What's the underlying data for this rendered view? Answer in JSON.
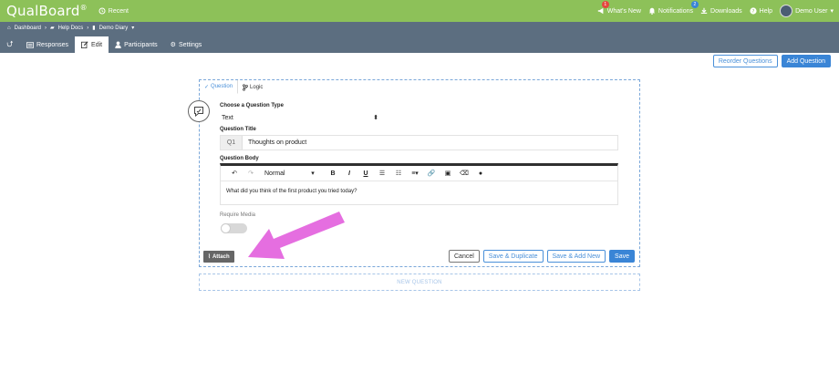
{
  "app": {
    "logo": "QualBoard",
    "logo_mark": "®",
    "recent_label": "Recent"
  },
  "topnav": {
    "whats_new": "What's New",
    "whats_new_badge": "1",
    "notifications": "Notifications",
    "notifications_badge": "2",
    "downloads": "Downloads",
    "help": "Help",
    "user": "Demo User"
  },
  "breadcrumb": {
    "dashboard": "Dashboard",
    "help_docs": "Help Docs",
    "demo_diary": "Demo Diary"
  },
  "tabs": {
    "responses": "Responses",
    "edit": "Edit",
    "participants": "Participants",
    "settings": "Settings"
  },
  "toolbar": {
    "reorder": "Reorder Questions",
    "add": "Add Question"
  },
  "question": {
    "tab_question": "Question",
    "tab_logic": "Logic",
    "type_label": "Choose a Question Type",
    "type_value": "Text",
    "title_label": "Question Title",
    "number": "Q1",
    "title_value": "Thoughts on product",
    "body_label": "Question Body",
    "format_value": "Normal",
    "body_value": "What did you think of the first product you tried today?",
    "require_media_label": "Require Media",
    "require_media_on": false,
    "attach_label": "Attach",
    "cancel": "Cancel",
    "save_duplicate": "Save & Duplicate",
    "save_add_new": "Save & Add New",
    "save": "Save"
  },
  "new_question": "NEW QUESTION",
  "colors": {
    "topbar": "#8dc159",
    "subbar": "#5c6e80",
    "accent": "#3a85d6",
    "annotation_arrow": "#e56ee0"
  }
}
